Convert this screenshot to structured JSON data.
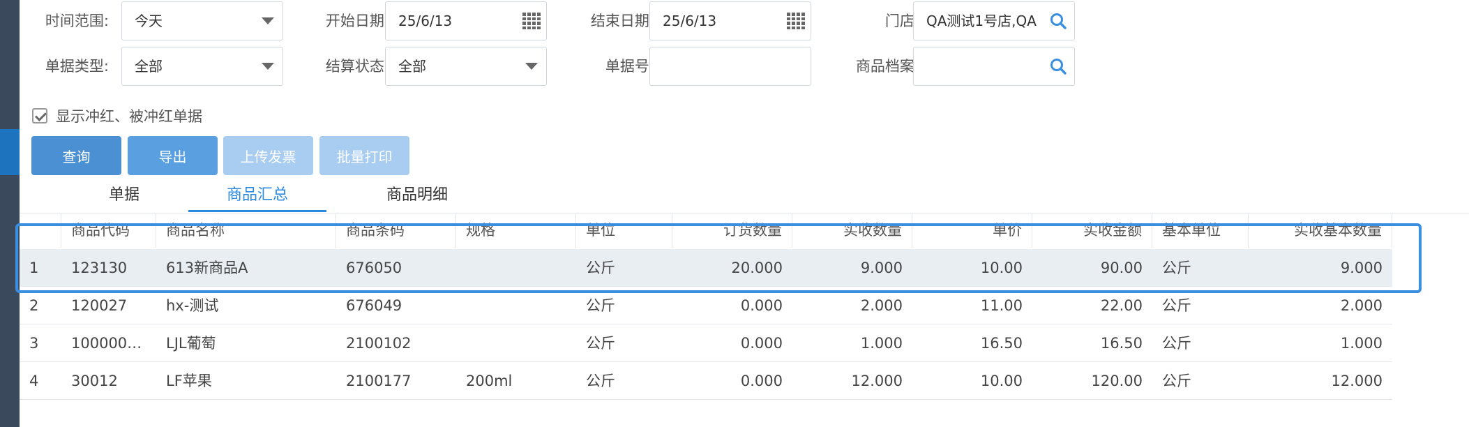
{
  "filters": {
    "time_range": {
      "label": "时间范围:",
      "value": "今天"
    },
    "start_date": {
      "label": "开始日期:",
      "value": "25/6/13"
    },
    "end_date": {
      "label": "结束日期:",
      "value": "25/6/13"
    },
    "store": {
      "label": "门店:",
      "value": "QA测试1号店,QA"
    },
    "doc_type": {
      "label": "单据类型:",
      "value": "全部"
    },
    "settle_status": {
      "label": "结算状态:",
      "value": "全部"
    },
    "doc_no": {
      "label": "单据号:",
      "value": ""
    },
    "product_archive": {
      "label": "商品档案:",
      "value": ""
    }
  },
  "checkbox": {
    "label": "显示冲红、被冲红单据",
    "checked": true
  },
  "buttons": {
    "query": "查询",
    "export": "导出",
    "upload_invoice": "上传发票",
    "batch_print": "批量打印"
  },
  "tabs": [
    {
      "label": "单据",
      "active": false
    },
    {
      "label": "商品汇总",
      "active": true
    },
    {
      "label": "商品明细",
      "active": false
    }
  ],
  "table": {
    "headers": [
      "",
      "商品代码",
      "商品名称",
      "商品条码",
      "规格",
      "单位",
      "订货数量",
      "实收数量",
      "单价",
      "实收金额",
      "基本单位",
      "实收基本数量"
    ],
    "rows": [
      [
        "1",
        "123130",
        "613新商品A",
        "676050",
        "",
        "公斤",
        "20.000",
        "9.000",
        "10.00",
        "90.00",
        "公斤",
        "9.000"
      ],
      [
        "2",
        "120027",
        "hx-测试",
        "676049",
        "",
        "公斤",
        "0.000",
        "2.000",
        "11.00",
        "22.00",
        "公斤",
        "2.000"
      ],
      [
        "3",
        "100000…",
        "LJL葡萄",
        "2100102",
        "",
        "公斤",
        "0.000",
        "1.000",
        "16.50",
        "16.50",
        "公斤",
        "1.000"
      ],
      [
        "4",
        "30012",
        "LF苹果",
        "2100177",
        "200ml",
        "公斤",
        "0.000",
        "12.000",
        "10.00",
        "120.00",
        "公斤",
        "12.000"
      ]
    ]
  },
  "colors": {
    "accent": "#2b89e0",
    "highlight_border": "#3a8fe0"
  }
}
